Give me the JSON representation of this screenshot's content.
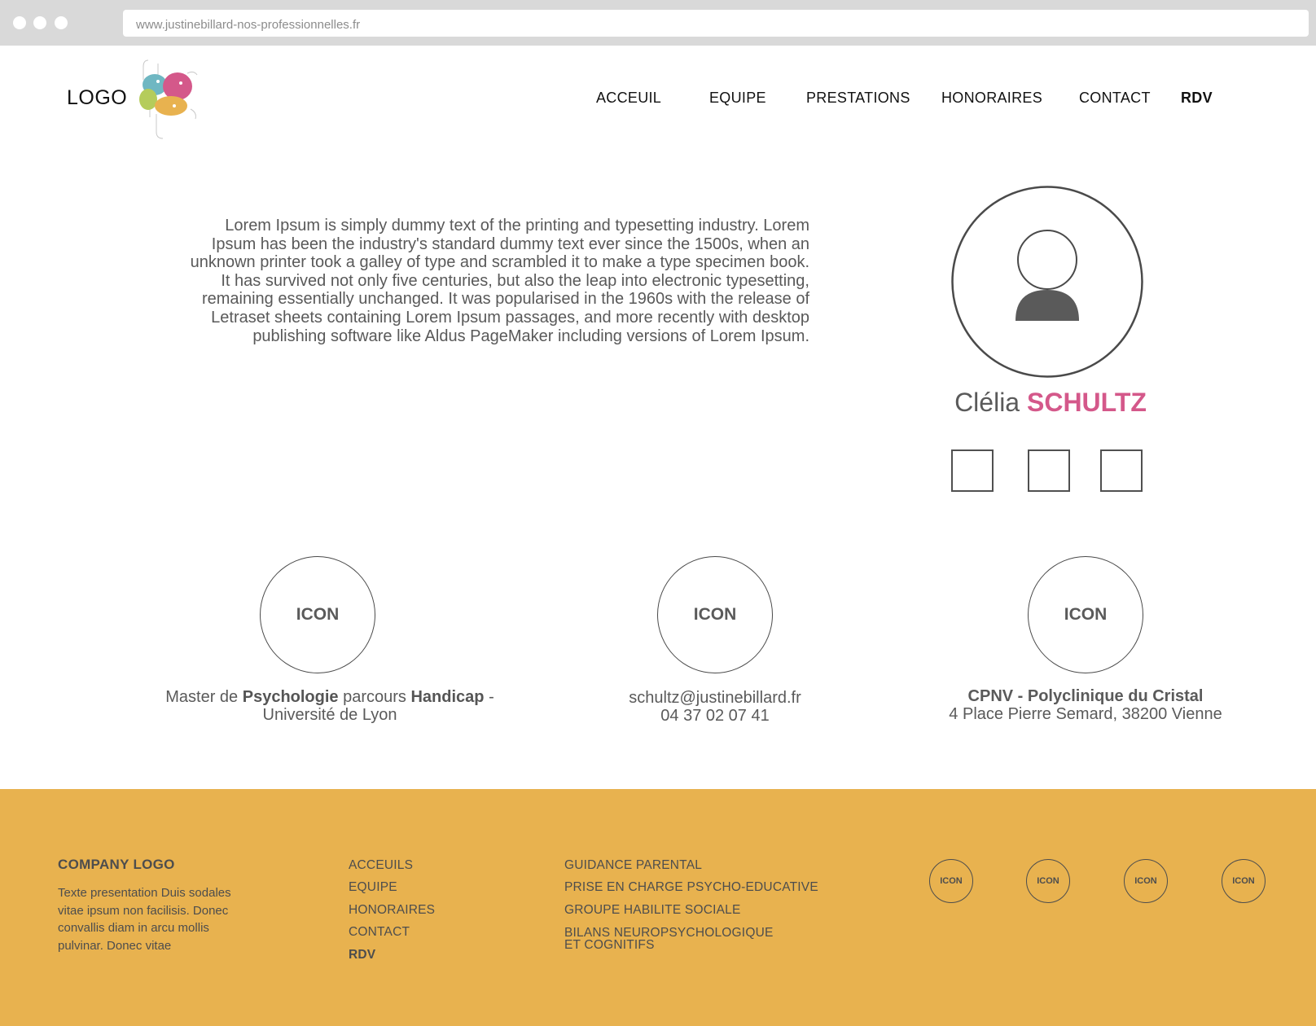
{
  "browser": {
    "url": "www.justinebillard-nos-professionnelles.fr"
  },
  "header": {
    "logo_text": "LOGO",
    "nav": [
      "ACCEUIL",
      "EQUIPE",
      "PRESTATIONS",
      "HONORAIRES",
      "CONTACT",
      "RDV"
    ]
  },
  "main": {
    "intro": "Lorem Ipsum is simply dummy text of the printing and typesetting industry. Lorem Ipsum has been the industry's standard dummy text ever since the 1500s, when an unknown printer took a galley of type and scrambled it to make a type specimen book. It has survived not only five centuries, but also the leap into electronic typesetting, remaining essentially unchanged. It was popularised in the 1960s with the release of Letraset sheets containing Lorem Ipsum passages, and more recently with desktop publishing software like Aldus PageMaker including versions of Lorem Ipsum."
  },
  "profile": {
    "first_name": "Clélia",
    "last_name": "SCHULTZ",
    "accent_color": "#d4588a"
  },
  "info": {
    "icon_label": "ICON",
    "education": {
      "prefix": "Master de ",
      "field": "Psychologie",
      "middle": " parcours ",
      "track": "Handicap",
      "suffix": " -",
      "university": "Université de Lyon"
    },
    "contact": {
      "email": "schultz@justinebillard.fr",
      "phone": "04 37 02 07 41"
    },
    "location": {
      "name": "CPNV - Polyclinique du Cristal",
      "address": "4 Place Pierre Semard, 38200 Vienne"
    }
  },
  "footer": {
    "background_color": "#e8b24f",
    "company_logo": "COMPANY LOGO",
    "description": "Texte presentation Duis sodales vitae ipsum non facilisis. Donec convallis diam in arcu mollis pulvinar. Donec vitae",
    "nav_links": [
      "ACCEUILS",
      "EQUIPE",
      "HONORAIRES",
      "CONTACT",
      "RDV"
    ],
    "services": [
      "GUIDANCE PARENTAL",
      "PRISE EN CHARGE PSYCHO-EDUCATIVE",
      "GROUPE HABILITE SOCIALE",
      "BILANS NEUROPSYCHOLOGIQUE",
      "ET COGNITIFS"
    ],
    "icon_label": "ICON"
  }
}
